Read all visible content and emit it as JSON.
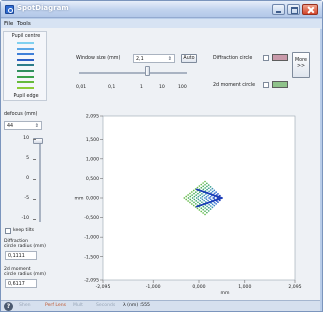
{
  "window": {
    "title": "SpotDiagram"
  },
  "menu": {
    "items": [
      "File",
      "Tools"
    ]
  },
  "pupil": {
    "top_label": "Pupil centre",
    "bottom_label": "Pupil edge",
    "line_colors": [
      "#7fd0f0",
      "#5aa6e6",
      "#3f7fd9",
      "#2d5fc4",
      "#2d7d8a",
      "#2f8f5e",
      "#3aa24a",
      "#66ba3c",
      "#8ccc38"
    ]
  },
  "defocus": {
    "label": "defocus (mm)",
    "value": "44",
    "ticks": [
      "10",
      "5",
      "0",
      "-5",
      "-10"
    ],
    "keep_tilts_label": "keep tilts"
  },
  "diffraction_radius": {
    "label_line1": "Diffraction",
    "label_line2": "circle radius (mm)",
    "value": "0,1111"
  },
  "moment_radius": {
    "label_line1": "2d moment",
    "label_line2": "circle radius (mm)",
    "value": "0,6117"
  },
  "window_size": {
    "label": "Window size (mm)",
    "value": "2,1",
    "auto_label": "Auto",
    "slider_ticks": [
      "0,01",
      "0,1",
      "1",
      "10",
      "100"
    ],
    "slider_level_fraction": 0.63
  },
  "diffraction_circle": {
    "label": "Diffraction circle",
    "color": "#c99aaa"
  },
  "moment_circle": {
    "label": "2d moment circle",
    "color": "#8fc28a"
  },
  "more_button": {
    "line1": "More",
    "line2": ">>"
  },
  "chart_data": {
    "type": "scatter",
    "ylabel": "mm",
    "xlabel": "mm",
    "xlim": [
      -2.095,
      2.095
    ],
    "ylim": [
      -2.095,
      2.095
    ],
    "xticks": [
      "-2,095",
      "-1,000",
      "0,000",
      "1,000",
      "2,095"
    ],
    "xtick_values": [
      -2.095,
      -1.0,
      0.0,
      1.0,
      2.095
    ],
    "yticks": [
      "2,095",
      "1,500",
      "1,000",
      "0,500",
      "0,000",
      "-0,500",
      "-1,000",
      "-1,500",
      "-2,095"
    ],
    "ytick_values": [
      2.095,
      1.5,
      1.0,
      0.5,
      0.0,
      -0.5,
      -1.0,
      -1.5,
      -2.095
    ],
    "spot_pattern": {
      "apex_x": 0.5,
      "rings": 9,
      "ring_colors": [
        "#1e3fb8",
        "#2b58c8",
        "#3470d0",
        "#3d86c9",
        "#3f95b2",
        "#3fa08e",
        "#3fa86d",
        "#4bb05a",
        "#67bb4d"
      ]
    }
  },
  "status": {
    "items": [
      "Shen",
      "Perf Lens",
      "Mult",
      "Seconds",
      "λ (nm) :555"
    ],
    "colors": [
      "#9aa7b8",
      "#c0572f",
      "#9aa7b8",
      "#9aa7b8",
      "#222222"
    ]
  }
}
